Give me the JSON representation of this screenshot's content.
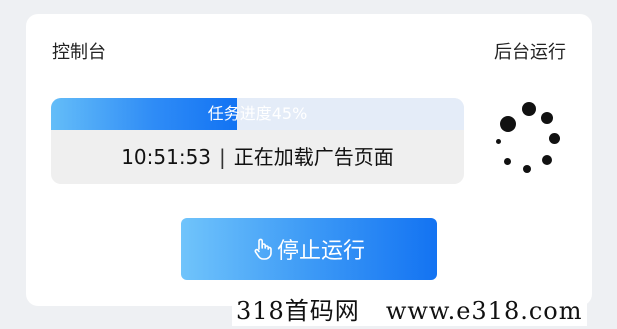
{
  "header": {
    "title": "控制台",
    "background_run_label": "后台运行"
  },
  "task": {
    "progress_label": "任务进度45%",
    "progress": 0.45,
    "time": "10:51:53",
    "separator": "|",
    "status": "正在加载广告页面"
  },
  "controls": {
    "stop_label": "停止运行",
    "stop_icon": "hand-pointer-icon"
  },
  "spinner": {
    "icon": "loading-spinner-icon"
  },
  "watermark": {
    "site_name": "318首码网",
    "url": "www.e318.com"
  },
  "colors": {
    "accent_start": "#64bdf8",
    "accent_end": "#1273f3",
    "card_bg": "#ffffff",
    "page_bg": "#eef0f3",
    "status_bg": "#efefef"
  }
}
